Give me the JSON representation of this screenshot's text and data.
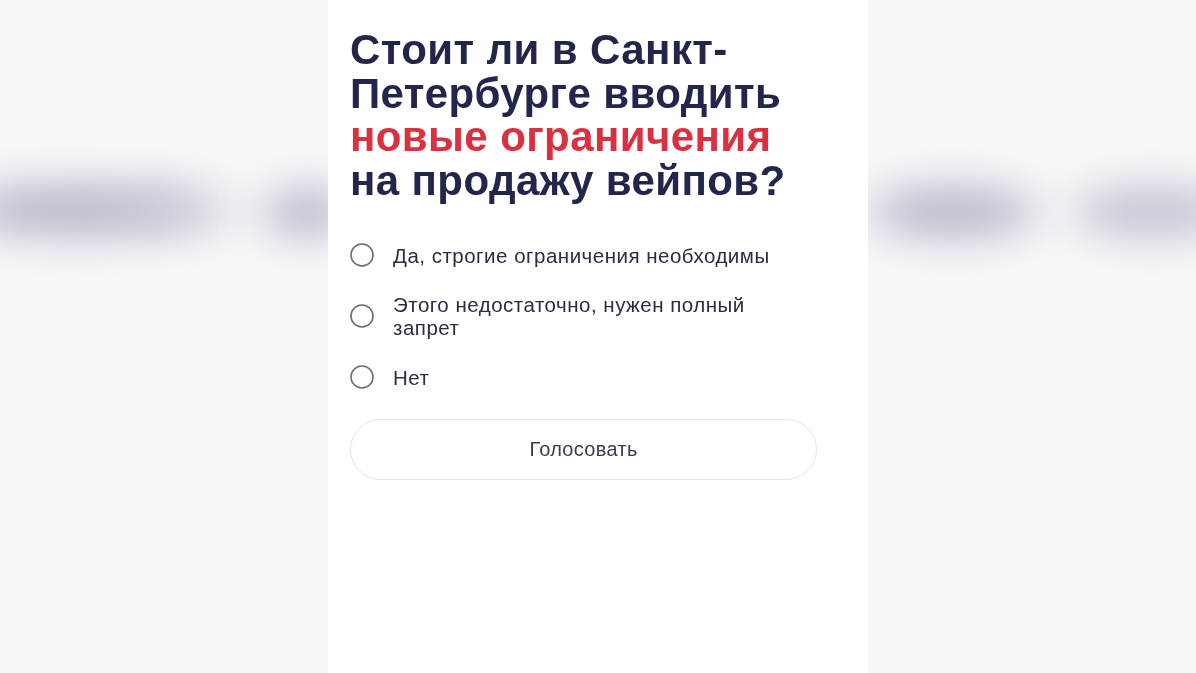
{
  "question": [
    {
      "text": "Стоит ли в Санкт-Петербурге вводить",
      "highlight": false
    },
    {
      "text": "новые ограничения",
      "highlight": true
    },
    {
      "text": "на продажу вейпов?",
      "highlight": false
    }
  ],
  "options": [
    {
      "label": "Да, строгие ограничения необходимы",
      "selected": false
    },
    {
      "label": "Этого недостаточно, нужен полный запрет",
      "selected": false
    },
    {
      "label": "Нет",
      "selected": false
    }
  ],
  "vote_button": {
    "label": "Голосовать"
  }
}
